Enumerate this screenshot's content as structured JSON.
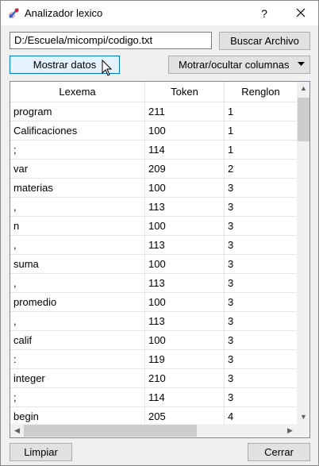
{
  "window": {
    "title": "Analizador lexico",
    "help_label": "?"
  },
  "file": {
    "path": "D:/Escuela/micompi/codigo.txt",
    "browse_label": "Buscar Archivo"
  },
  "actions": {
    "show_label": "Mostrar datos",
    "columns_label": "Motrar/ocultar columnas"
  },
  "table": {
    "headers": [
      "Lexema",
      "Token",
      "Renglon"
    ],
    "rows": [
      [
        "program",
        "211",
        "1"
      ],
      [
        "Calificaciones",
        "100",
        "1"
      ],
      [
        ";",
        "114",
        "1"
      ],
      [
        "var",
        "209",
        "2"
      ],
      [
        "materias",
        "100",
        "3"
      ],
      [
        ",",
        "113",
        "3"
      ],
      [
        "n",
        "100",
        "3"
      ],
      [
        ",",
        "113",
        "3"
      ],
      [
        "suma",
        "100",
        "3"
      ],
      [
        ",",
        "113",
        "3"
      ],
      [
        "promedio",
        "100",
        "3"
      ],
      [
        ",",
        "113",
        "3"
      ],
      [
        "calif",
        "100",
        "3"
      ],
      [
        ":",
        "119",
        "3"
      ],
      [
        "integer",
        "210",
        "3"
      ],
      [
        ";",
        "114",
        "3"
      ],
      [
        "begin",
        "205",
        "4"
      ]
    ]
  },
  "footer": {
    "clear_label": "Limpiar",
    "close_label": "Cerrar"
  },
  "icons": {
    "app": "app-logo-icon",
    "close": "close-icon",
    "dropdown": "chevron-down-icon"
  },
  "colors": {
    "focus_border": "#0078d7",
    "focus_fill": "#e5f1fb"
  }
}
